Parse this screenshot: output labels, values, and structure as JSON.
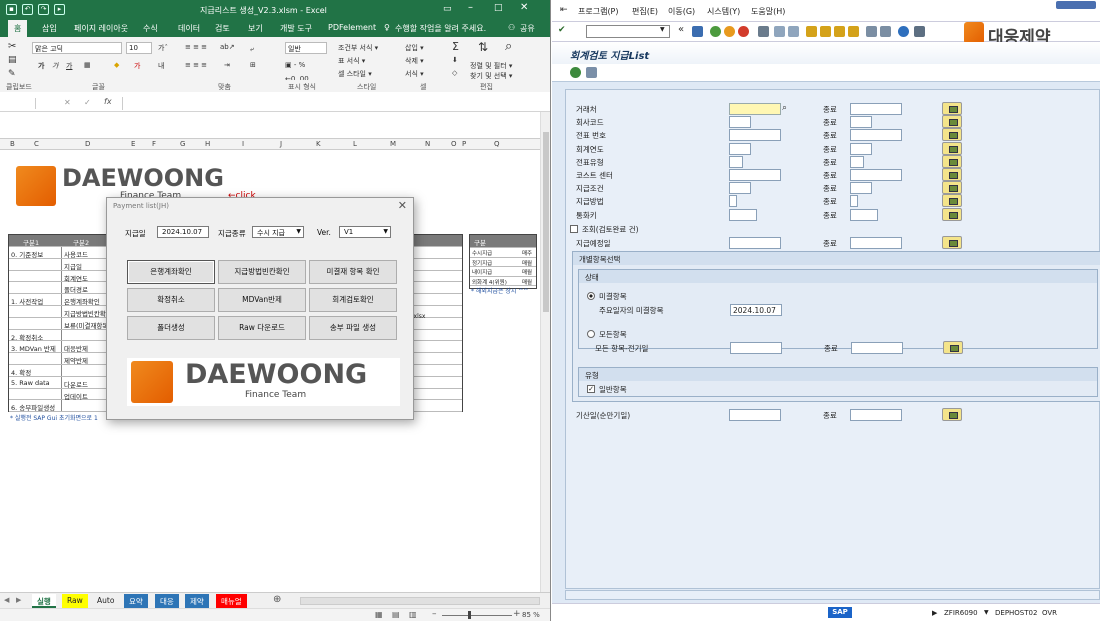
{
  "excel": {
    "title": "지급리스트 생성_V2.3.xlsm - Excel",
    "tabs": [
      "홈",
      "삽입",
      "페이지 레이아웃",
      "수식",
      "데이터",
      "검토",
      "보기",
      "개발 도구",
      "PDFelement"
    ],
    "tell_me": "수행할 작업을 알려 주세요.",
    "share": "공유",
    "ribbon": {
      "font_name": "맑은 고딕",
      "font_size": "10",
      "number_format": "일반",
      "format_items": [
        "조건부 서식 ▾",
        "표 서식 ▾",
        "셀 스타일 ▾"
      ],
      "cell_items": [
        "삽입 ▾",
        "삭제 ▾",
        "서식 ▾"
      ],
      "edit_items": [
        "정렬 및 필터 ▾",
        "찾기 및 선택 ▾"
      ],
      "groups": [
        "클립보드",
        "글꼴",
        "맞춤",
        "표시 형식",
        "스타일",
        "셀",
        "편집"
      ]
    },
    "columns": [
      "B",
      "C",
      "D",
      "E",
      "F",
      "G",
      "H",
      "I",
      "J",
      "K",
      "L",
      "M",
      "N",
      "O",
      "P",
      "Q"
    ],
    "logo_text": "DAEWOONG",
    "logo_sub": "Finance Team",
    "click_note": "←click",
    "table": {
      "headers": [
        "구분1",
        "구분2"
      ],
      "rows": [
        [
          "0. 기준정보",
          "사용코드"
        ],
        [
          "",
          "지급일"
        ],
        [
          "",
          "회계연도"
        ],
        [
          "",
          "폴더경로"
        ],
        [
          "1. 사전작업",
          "은행계좌확인"
        ],
        [
          "",
          "지급방법빈칸확인"
        ],
        [
          "",
          "보류(미결재항목)"
        ],
        [
          "2. 확정취소",
          ""
        ],
        [
          "3. MDVan 반제",
          "대응반제"
        ],
        [
          "",
          "제약반제"
        ],
        [
          "4. 확정",
          ""
        ],
        [
          "5. Raw data",
          "다운로드"
        ],
        [
          "",
          "업데이트"
        ],
        [
          "6. 송부파일생성",
          ""
        ]
      ],
      "note": "* 실행전 SAP Gui 초기화면으로 1",
      "xlsx_tag": "07.xlsx"
    },
    "side_table": {
      "header": "구분",
      "rows": [
        [
          "수시지급",
          "매주"
        ],
        [
          "정기지급",
          "매월"
        ],
        [
          "내이지급",
          "매월"
        ],
        [
          "외화계 4(위원)",
          "매월"
        ]
      ],
      "note": "* 해외지급은 상시 ^^"
    },
    "sheet_tabs": [
      {
        "label": "실행",
        "color": "#ffffff",
        "fg": "#217346",
        "active": true
      },
      {
        "label": "Raw",
        "color": "#ffff00",
        "fg": "#222222"
      },
      {
        "label": "Auto",
        "color": "#f0f0f0",
        "fg": "#222222"
      },
      {
        "label": "요약",
        "color": "#2e75b6",
        "fg": "#ffffff"
      },
      {
        "label": "대응",
        "color": "#2e75b6",
        "fg": "#ffffff"
      },
      {
        "label": "제약",
        "color": "#2e75b6",
        "fg": "#ffffff"
      },
      {
        "label": "매뉴얼",
        "color": "#ff0000",
        "fg": "#ffffff"
      }
    ],
    "zoom": "85 %"
  },
  "dialog": {
    "title": "Payment list(JH)",
    "date_label": "지급일",
    "date_value": "2024.10.07",
    "type_label": "지급종류",
    "type_value": "수시 지급",
    "ver_label": "Ver.",
    "ver_value": "V1",
    "buttons": [
      "은행계좌확인",
      "지급방법빈칸확인",
      "미결재 항목 확인",
      "확정취소",
      "MDVan반제",
      "회계검토확인",
      "폴더생성",
      "Raw 다운로드",
      "송부 파일 생성"
    ],
    "logo_text": "DAEWOONG",
    "logo_sub": "Finance Team"
  },
  "sap": {
    "menus": [
      "프로그램(P)",
      "편집(E)",
      "이동(G)",
      "시스템(Y)",
      "도움말(H)"
    ],
    "brand": "대웅제약",
    "title": "회계검토 지급List",
    "to_label": "종료",
    "fields": [
      "거래처",
      "회사코드",
      "전표 번호",
      "회계연도",
      "전표유형",
      "코스트 센터",
      "지급조건",
      "지급방법",
      "통화키"
    ],
    "lookup_label": "조회(검토완료 건)",
    "pay_date_label": "지급예정일",
    "group_title": "개별항목선택",
    "status_group": "상태",
    "open_items": "미결항목",
    "key_date_label": "주요일자의 미결항목",
    "key_date_value": "2024.10.07",
    "all_items": "모든항목",
    "all_items_period": "모든 항목-전기일",
    "type_group": "유형",
    "normal_items": "일반항목",
    "baseline_label": "기산일(순만기일)",
    "status_bar": [
      "ZFIR6090",
      "DEPHOST02",
      "OVR"
    ],
    "sap_logo": "SAP"
  }
}
